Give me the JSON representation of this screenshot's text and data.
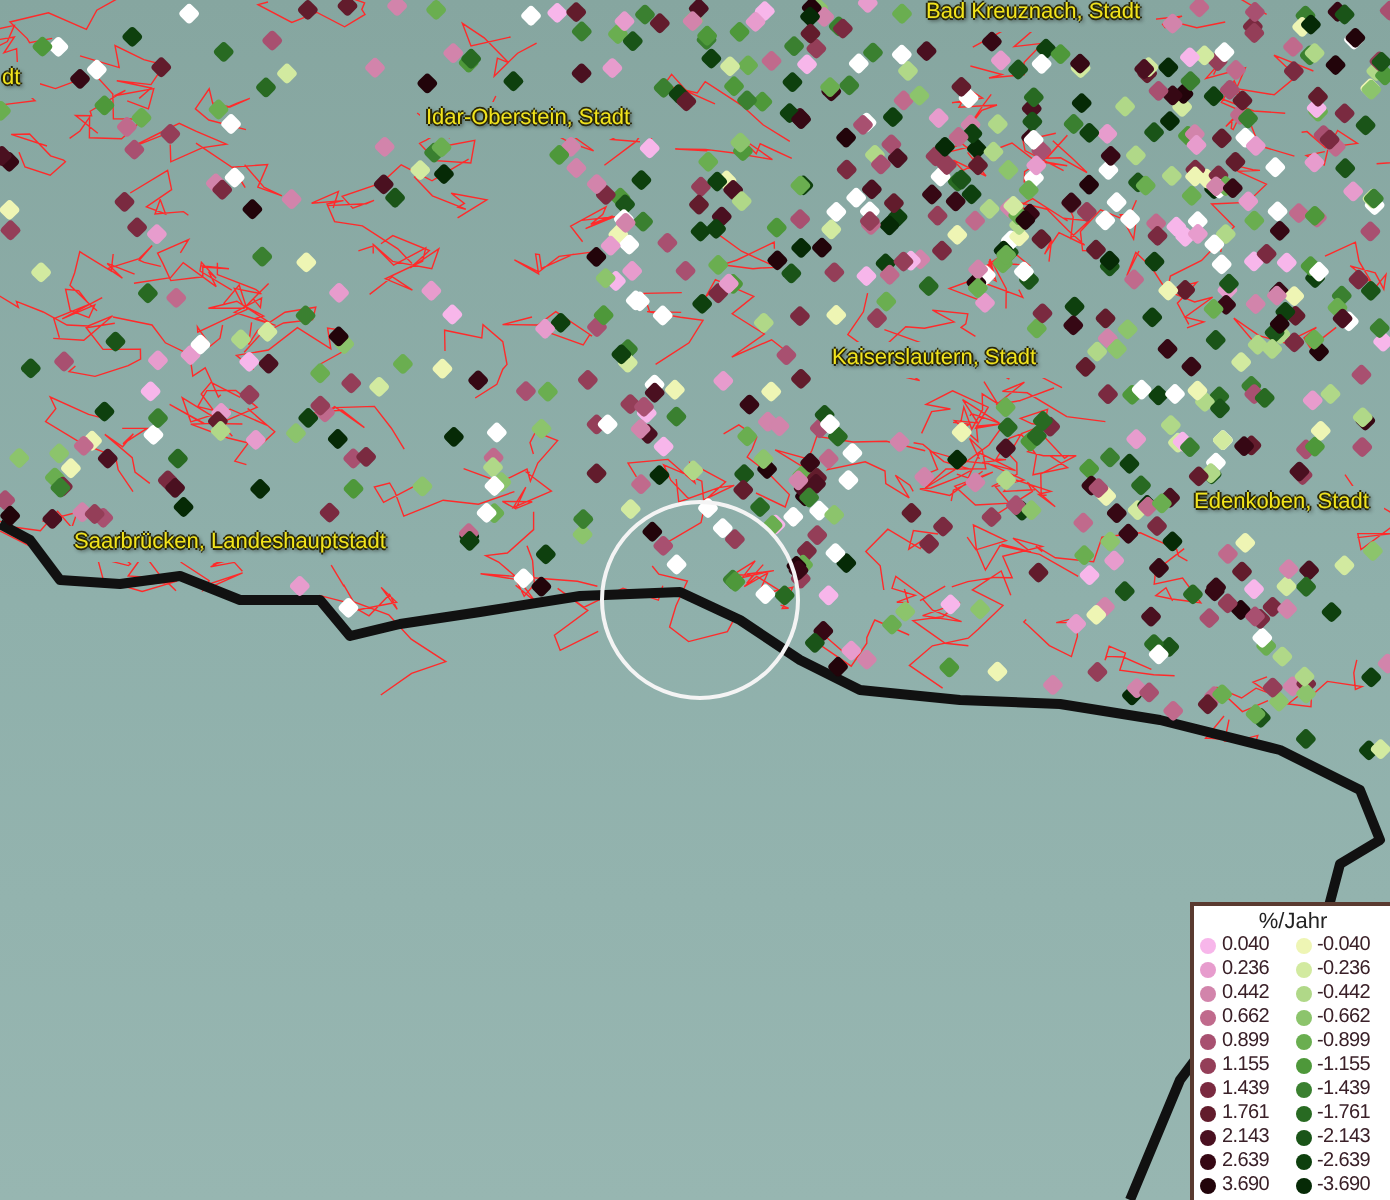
{
  "map": {
    "labels": [
      {
        "text": "dt"
      },
      {
        "text": "Bad Kreuznach, Stadt"
      },
      {
        "text": "Idar-Oberstein, Stadt"
      },
      {
        "text": "Kaiserslautern, Stadt"
      },
      {
        "text": "Edenkoben, Stadt"
      },
      {
        "text": "Saarbrücken, Landeshauptstadt"
      }
    ]
  },
  "legend": {
    "title": "%/Jahr",
    "items": [
      {
        "label": "0.040",
        "color": "#f7b6ea"
      },
      {
        "label": "-0.040",
        "color": "#eef5b4"
      },
      {
        "label": "0.236",
        "color": "#e79ccd"
      },
      {
        "label": "-0.236",
        "color": "#d2eaa0"
      },
      {
        "label": "0.442",
        "color": "#d284ab"
      },
      {
        "label": "-0.442",
        "color": "#b0d888"
      },
      {
        "label": "0.662",
        "color": "#c06a8c"
      },
      {
        "label": "-0.662",
        "color": "#8cc46c"
      },
      {
        "label": "0.899",
        "color": "#a85070"
      },
      {
        "label": "-0.899",
        "color": "#6aae50"
      },
      {
        "label": "1.155",
        "color": "#943e58"
      },
      {
        "label": "-1.155",
        "color": "#4e983a"
      },
      {
        "label": "1.439",
        "color": "#7a2a40"
      },
      {
        "label": "-1.439",
        "color": "#3a8030"
      },
      {
        "label": "1.761",
        "color": "#621c2c"
      },
      {
        "label": "-1.761",
        "color": "#286a22"
      },
      {
        "label": "2.143",
        "color": "#4a1020"
      },
      {
        "label": "-2.143",
        "color": "#1a5418"
      },
      {
        "label": "2.639",
        "color": "#360814"
      },
      {
        "label": "-2.639",
        "color": "#0e400e"
      },
      {
        "label": "3.690",
        "color": "#22040a"
      },
      {
        "label": "-3.690",
        "color": "#062a06"
      }
    ]
  }
}
